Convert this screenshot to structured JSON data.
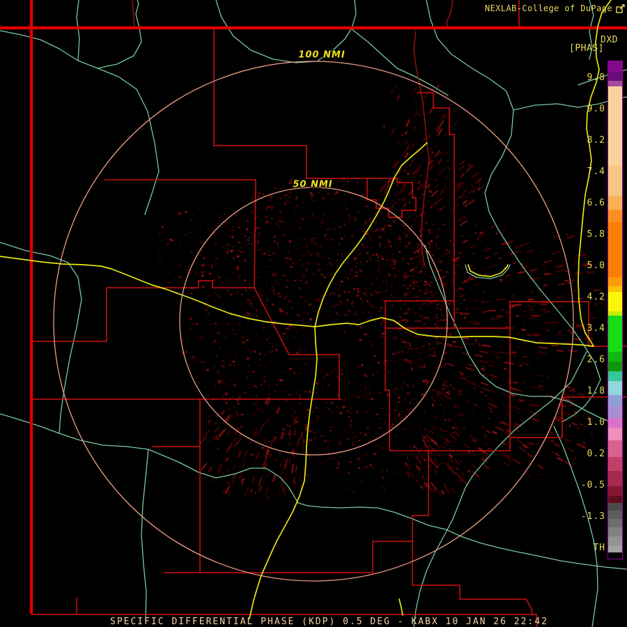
{
  "header": {
    "title": "NEXLAB-College of DuPage"
  },
  "product": {
    "id": "DXD",
    "units_label": "[PHAS]"
  },
  "range_rings": {
    "outer_label": "100 NMI",
    "inner_label": "50 NMI"
  },
  "caption": "SPECIFIC DIFFERENTIAL PHASE (KDP) 0.5 DEG - KABX 10 JAN 26 22:42",
  "colorbar": {
    "tick_labels": [
      "9.8",
      "9.0",
      "8.2",
      "7.4",
      "6.6",
      "5.8",
      "5.0",
      "4.2",
      "3.4",
      "2.6",
      "1.8",
      "1.0",
      "0.2",
      "-0.5",
      "-1.3",
      "TH"
    ],
    "segments": [
      [
        15,
        "#82098c"
      ],
      [
        13,
        "#6c0b7c"
      ],
      [
        8,
        "#a34b9e"
      ],
      [
        114,
        "#f9d29b"
      ],
      [
        43,
        "#f6c689"
      ],
      [
        20,
        "#f7b056"
      ],
      [
        18,
        "#f99020"
      ],
      [
        79,
        "#fa7e06"
      ],
      [
        13,
        "#fb9b07"
      ],
      [
        8,
        "#fcc204"
      ],
      [
        28,
        "#f9f803"
      ],
      [
        6,
        "#c4ef04"
      ],
      [
        52,
        "#17dc17"
      ],
      [
        14,
        "#12b812"
      ],
      [
        14,
        "#109710"
      ],
      [
        14,
        "#35c79b"
      ],
      [
        20,
        "#93d5da"
      ],
      [
        16,
        "#8f9fd8"
      ],
      [
        17,
        "#a98fd2"
      ],
      [
        14,
        "#d873c9"
      ],
      [
        18,
        "#ee8fb9"
      ],
      [
        24,
        "#d96192"
      ],
      [
        20,
        "#c24168"
      ],
      [
        22,
        "#a62a4b"
      ],
      [
        14,
        "#831730"
      ],
      [
        10,
        "#5e0d1c"
      ],
      [
        11,
        "#4b4b4b"
      ],
      [
        12,
        "#5d5d5d"
      ],
      [
        12,
        "#6f6f6f"
      ],
      [
        13,
        "#818181"
      ],
      [
        13,
        "#939393"
      ],
      [
        10,
        "#a1a1a1"
      ],
      [
        9,
        "#000000"
      ]
    ]
  },
  "palette": {
    "background": "#000000",
    "state": "#dd0000",
    "county": "#cf1111",
    "carmine": "#9b1212",
    "river": "#7cc8a0",
    "road": "#e8e810",
    "ring": "#ee9f86",
    "textYellow": "#e8dc60",
    "ringLabel": "#f0e020",
    "captionText": "#f8d2a6",
    "cbBorder": "#990099",
    "echoColors": "#3c0303,#4c0505,#5c0606,#6b0808,#7a0a0a,#8c0f0f,#9c1414"
  }
}
